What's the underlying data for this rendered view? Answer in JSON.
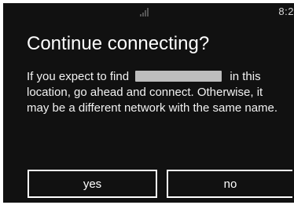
{
  "status_bar": {
    "time": "8:2",
    "signal_icon": "signal-bars-icon"
  },
  "dialog": {
    "title": "Continue connecting?",
    "body_prefix": "If you expect to find",
    "redacted_network_name": "",
    "body_suffix": "in this location, go ahead and connect. Otherwise, it may be a different network with the same name.",
    "yes_label": "yes",
    "no_label": "no"
  },
  "colors": {
    "background": "#111111",
    "text": "#ffffff",
    "redaction": "#bdbdbd"
  }
}
